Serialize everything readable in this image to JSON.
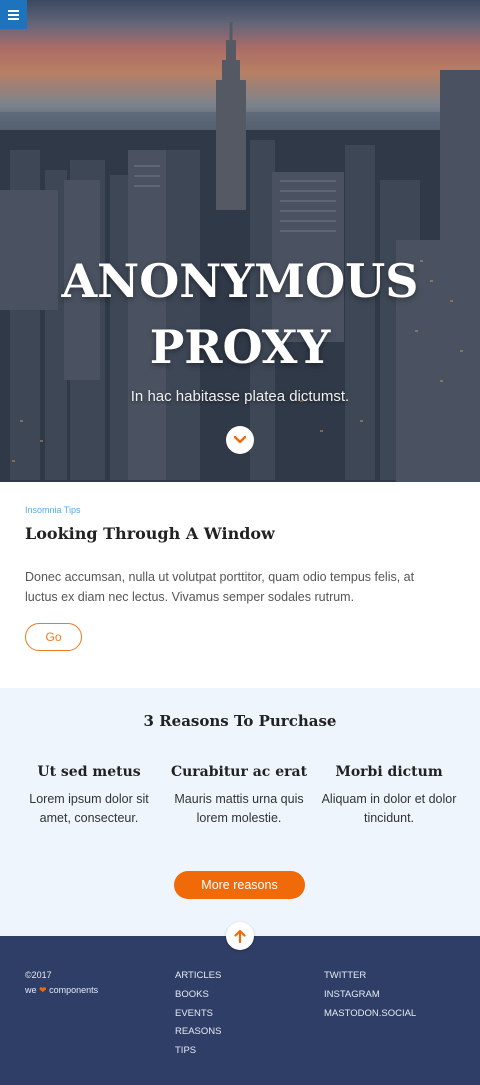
{
  "hero": {
    "title_line1": "ANONYMOUS",
    "title_line2": "PROXY",
    "subtitle": "In hac habitasse platea dictumst."
  },
  "article": {
    "tag": "Insomnia Tips",
    "title": "Looking Through A Window",
    "body": "Donec accumsan, nulla ut volutpat porttitor, quam odio tempus felis, at luctus ex diam nec lectus. Vivamus semper sodales rutrum.",
    "button_label": "Go"
  },
  "reasons": {
    "title": "3 Reasons To Purchase",
    "items": [
      {
        "heading": "Ut sed metus",
        "text": "Lorem ipsum dolor sit amet, consecteur."
      },
      {
        "heading": "Curabitur ac erat",
        "text": "Mauris mattis urna quis lorem molestie."
      },
      {
        "heading": "Morbi dictum",
        "text": "Aliquam in dolor et dolor tincidunt."
      }
    ],
    "button_label": "More reasons"
  },
  "footer": {
    "copyright": "©2017",
    "credit_prefix": "we",
    "credit_suffix": "components",
    "links_col1": [
      "ARTICLES",
      "BOOKS",
      "EVENTS",
      "REASONS",
      "TIPS"
    ],
    "links_col2": [
      "TWITTER",
      "INSTAGRAM",
      "MASTODON.SOCIAL"
    ]
  },
  "colors": {
    "accent": "#f06a0a",
    "menu_blue": "#1e73be",
    "footer_bg": "#2f3e66",
    "reasons_bg": "#eef5fc"
  },
  "icons": {
    "menu": "hamburger-icon",
    "down": "chevron-down-icon",
    "up": "arrow-up-icon",
    "heart": "heart-icon"
  }
}
